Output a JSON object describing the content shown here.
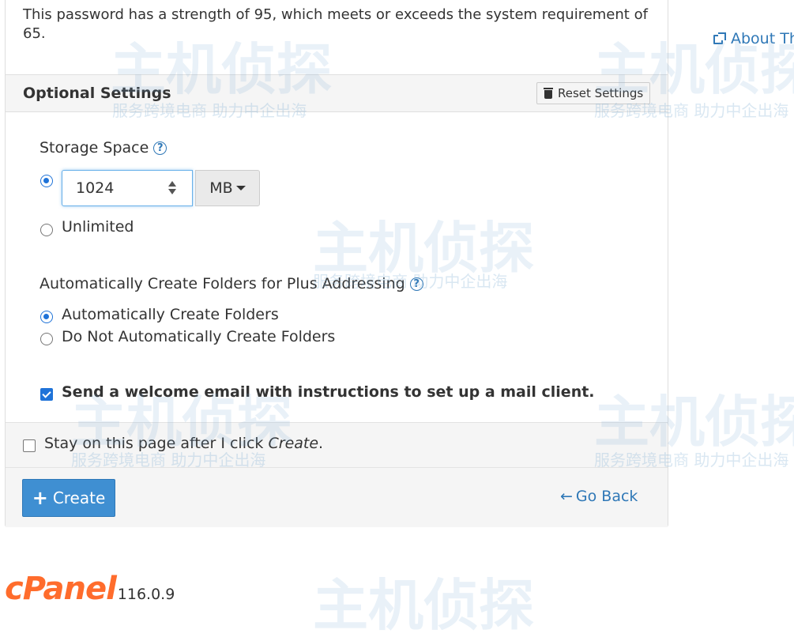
{
  "password": {
    "strength_message": "This password has a strength of 95, which meets or exceeds the system requirement of 65."
  },
  "about_link": "About Th",
  "optional_settings": {
    "title": "Optional Settings",
    "reset_label": "Reset Settings"
  },
  "storage": {
    "label": "Storage Space",
    "help": "?",
    "value": "1024",
    "unit": "MB",
    "unlimited_label": "Unlimited",
    "selected": "custom"
  },
  "plus_addressing": {
    "label": "Automatically Create Folders for Plus Addressing",
    "help": "?",
    "options": [
      "Automatically Create Folders",
      "Do Not Automatically Create Folders"
    ],
    "selected_index": 0
  },
  "welcome_email": {
    "label": "Send a welcome email with instructions to set up a mail client.",
    "checked": true
  },
  "footer": {
    "stay_label_prefix": "Stay on this page after I click ",
    "stay_label_em": "Create",
    "stay_label_suffix": ".",
    "stay_checked": false,
    "create_label": "Create",
    "go_back_label": "Go Back"
  },
  "brand": {
    "logo": "cPanel",
    "version": "116.0.9"
  },
  "watermark": {
    "main": "主机侦探",
    "sub": "服务跨境电商 助力中企出海"
  },
  "colors": {
    "primary": "#3f8fd2",
    "link": "#2f78b7",
    "logo": "#ff6c2c"
  }
}
